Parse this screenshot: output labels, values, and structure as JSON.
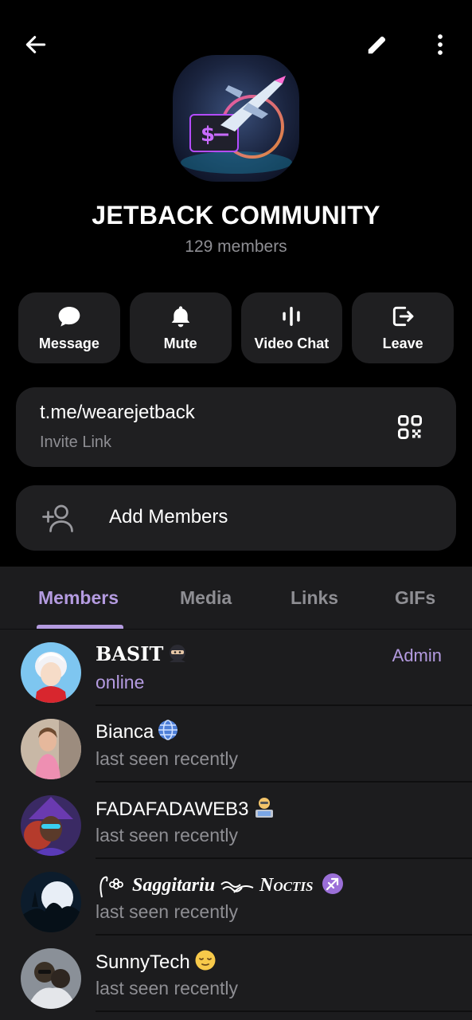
{
  "group": {
    "title": "JETBACK COMMUNITY",
    "subtitle": "129 members"
  },
  "toolbar": {
    "back_icon": "arrow-left-icon",
    "edit_icon": "pencil-icon",
    "more_icon": "more-vertical-icon"
  },
  "actions": [
    {
      "label": "Message",
      "icon": "chat-bubble-icon"
    },
    {
      "label": "Mute",
      "icon": "bell-icon"
    },
    {
      "label": "Video Chat",
      "icon": "voice-chat-icon"
    },
    {
      "label": "Leave",
      "icon": "leave-icon"
    }
  ],
  "invite": {
    "url": "t.me/wearejetback",
    "label": "Invite Link",
    "qr_icon": "qr-code-icon"
  },
  "add_members": {
    "label": "Add Members",
    "icon": "add-person-icon"
  },
  "tabs": [
    {
      "label": "Members",
      "active": true
    },
    {
      "label": "Media",
      "active": false
    },
    {
      "label": "Links",
      "active": false
    },
    {
      "label": "GIFs",
      "active": false
    }
  ],
  "members": [
    {
      "name": "BASIT",
      "status": "online",
      "role": "Admin"
    },
    {
      "name": "Bianca",
      "status": "last seen recently",
      "role": ""
    },
    {
      "name": "FADAFADAWEB3",
      "status": "last seen recently",
      "role": ""
    },
    {
      "name": "Saggitariu",
      "name_suffix": "Noctis",
      "status": "last seen recently",
      "role": ""
    },
    {
      "name": "SunnyTech",
      "status": "last seen recently",
      "role": ""
    }
  ],
  "colors": {
    "accent": "#b49be0",
    "background": "#000000",
    "card": "#1f1f21",
    "panel": "#1c1c1e",
    "muted_text": "#8e8e93"
  }
}
